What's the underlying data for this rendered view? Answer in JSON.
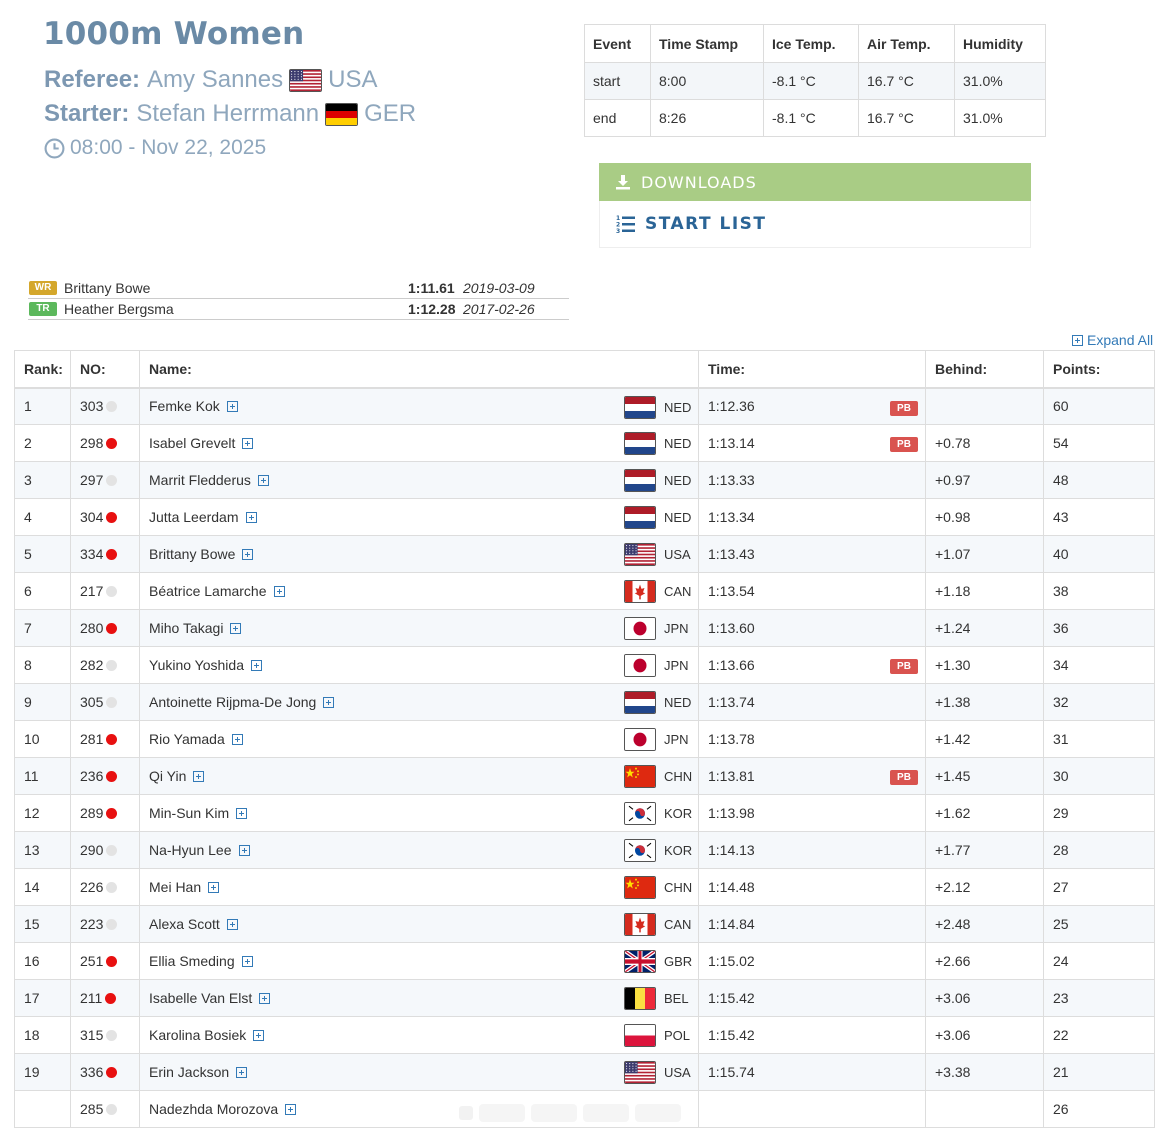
{
  "header": {
    "title": "1000m Women",
    "referee_label": "Referee:",
    "referee_name": "Amy Sannes",
    "referee_country": "USA",
    "starter_label": "Starter:",
    "starter_name": "Stefan Herrmann",
    "starter_country": "GER",
    "datetime": "08:00 - Nov 22, 2025"
  },
  "weather": {
    "headers": [
      "Event",
      "Time Stamp",
      "Ice Temp.",
      "Air Temp.",
      "Humidity"
    ],
    "rows": [
      [
        "start",
        "8:00",
        "-8.1 °C",
        "16.7 °C",
        "31.0%"
      ],
      [
        "end",
        "8:26",
        "-8.1 °C",
        "16.7 °C",
        "31.0%"
      ]
    ]
  },
  "actions": {
    "downloads": "DOWNLOADS",
    "start_list": "START LIST",
    "expand_all": "Expand All"
  },
  "records": [
    {
      "badge": "WR",
      "badge_color": "#d4a72c",
      "name": "Brittany Bowe",
      "time": "1:11.61",
      "date": "2019-03-09"
    },
    {
      "badge": "TR",
      "badge_color": "#5cb85c",
      "name": "Heather Bergsma",
      "time": "1:12.28",
      "date": "2017-02-26"
    }
  ],
  "results": {
    "headers": [
      "Rank:",
      "NO:",
      "Name:",
      "Time:",
      "Behind:",
      "Points:"
    ],
    "pb_label": "PB",
    "rows": [
      {
        "rank": "1",
        "no": "303",
        "dot": false,
        "name": "Femke Kok",
        "country": "NED",
        "time": "1:12.36",
        "pb": true,
        "behind": "",
        "points": "60"
      },
      {
        "rank": "2",
        "no": "298",
        "dot": true,
        "name": "Isabel Grevelt",
        "country": "NED",
        "time": "1:13.14",
        "pb": true,
        "behind": "+0.78",
        "points": "54"
      },
      {
        "rank": "3",
        "no": "297",
        "dot": false,
        "name": "Marrit Fledderus",
        "country": "NED",
        "time": "1:13.33",
        "pb": false,
        "behind": "+0.97",
        "points": "48"
      },
      {
        "rank": "4",
        "no": "304",
        "dot": true,
        "name": "Jutta Leerdam",
        "country": "NED",
        "time": "1:13.34",
        "pb": false,
        "behind": "+0.98",
        "points": "43"
      },
      {
        "rank": "5",
        "no": "334",
        "dot": true,
        "name": "Brittany Bowe",
        "country": "USA",
        "time": "1:13.43",
        "pb": false,
        "behind": "+1.07",
        "points": "40"
      },
      {
        "rank": "6",
        "no": "217",
        "dot": false,
        "name": "Béatrice Lamarche",
        "country": "CAN",
        "time": "1:13.54",
        "pb": false,
        "behind": "+1.18",
        "points": "38"
      },
      {
        "rank": "7",
        "no": "280",
        "dot": true,
        "name": "Miho Takagi",
        "country": "JPN",
        "time": "1:13.60",
        "pb": false,
        "behind": "+1.24",
        "points": "36"
      },
      {
        "rank": "8",
        "no": "282",
        "dot": false,
        "name": "Yukino Yoshida",
        "country": "JPN",
        "time": "1:13.66",
        "pb": true,
        "behind": "+1.30",
        "points": "34"
      },
      {
        "rank": "9",
        "no": "305",
        "dot": false,
        "name": "Antoinette Rijpma-De Jong",
        "country": "NED",
        "time": "1:13.74",
        "pb": false,
        "behind": "+1.38",
        "points": "32"
      },
      {
        "rank": "10",
        "no": "281",
        "dot": true,
        "name": "Rio Yamada",
        "country": "JPN",
        "time": "1:13.78",
        "pb": false,
        "behind": "+1.42",
        "points": "31"
      },
      {
        "rank": "11",
        "no": "236",
        "dot": true,
        "name": "Qi Yin",
        "country": "CHN",
        "time": "1:13.81",
        "pb": true,
        "behind": "+1.45",
        "points": "30"
      },
      {
        "rank": "12",
        "no": "289",
        "dot": true,
        "name": "Min-Sun Kim",
        "country": "KOR",
        "time": "1:13.98",
        "pb": false,
        "behind": "+1.62",
        "points": "29"
      },
      {
        "rank": "13",
        "no": "290",
        "dot": false,
        "name": "Na-Hyun Lee",
        "country": "KOR",
        "time": "1:14.13",
        "pb": false,
        "behind": "+1.77",
        "points": "28"
      },
      {
        "rank": "14",
        "no": "226",
        "dot": false,
        "name": "Mei Han",
        "country": "CHN",
        "time": "1:14.48",
        "pb": false,
        "behind": "+2.12",
        "points": "27"
      },
      {
        "rank": "15",
        "no": "223",
        "dot": false,
        "name": "Alexa Scott",
        "country": "CAN",
        "time": "1:14.84",
        "pb": false,
        "behind": "+2.48",
        "points": "25"
      },
      {
        "rank": "16",
        "no": "251",
        "dot": true,
        "name": "Ellia Smeding",
        "country": "GBR",
        "time": "1:15.02",
        "pb": false,
        "behind": "+2.66",
        "points": "24"
      },
      {
        "rank": "17",
        "no": "211",
        "dot": true,
        "name": "Isabelle Van Elst",
        "country": "BEL",
        "time": "1:15.42",
        "pb": false,
        "behind": "+3.06",
        "points": "23"
      },
      {
        "rank": "18",
        "no": "315",
        "dot": false,
        "name": "Karolina Bosiek",
        "country": "POL",
        "time": "1:15.42",
        "pb": false,
        "behind": "+3.06",
        "points": "22"
      },
      {
        "rank": "19",
        "no": "336",
        "dot": true,
        "name": "Erin Jackson",
        "country": "USA",
        "time": "1:15.74",
        "pb": false,
        "behind": "+3.38",
        "points": "21"
      },
      {
        "rank": "",
        "no": "285",
        "dot": false,
        "name": "Nadezhda Morozova",
        "country": "",
        "time": "",
        "pb": false,
        "behind": "",
        "points": "26"
      }
    ]
  },
  "colors": {
    "title": "#6a8aa6",
    "downloads_bg": "#a9cc85",
    "link": "#337ab7",
    "pb_badge": "#d9534f",
    "dot_active": "#e81010"
  }
}
